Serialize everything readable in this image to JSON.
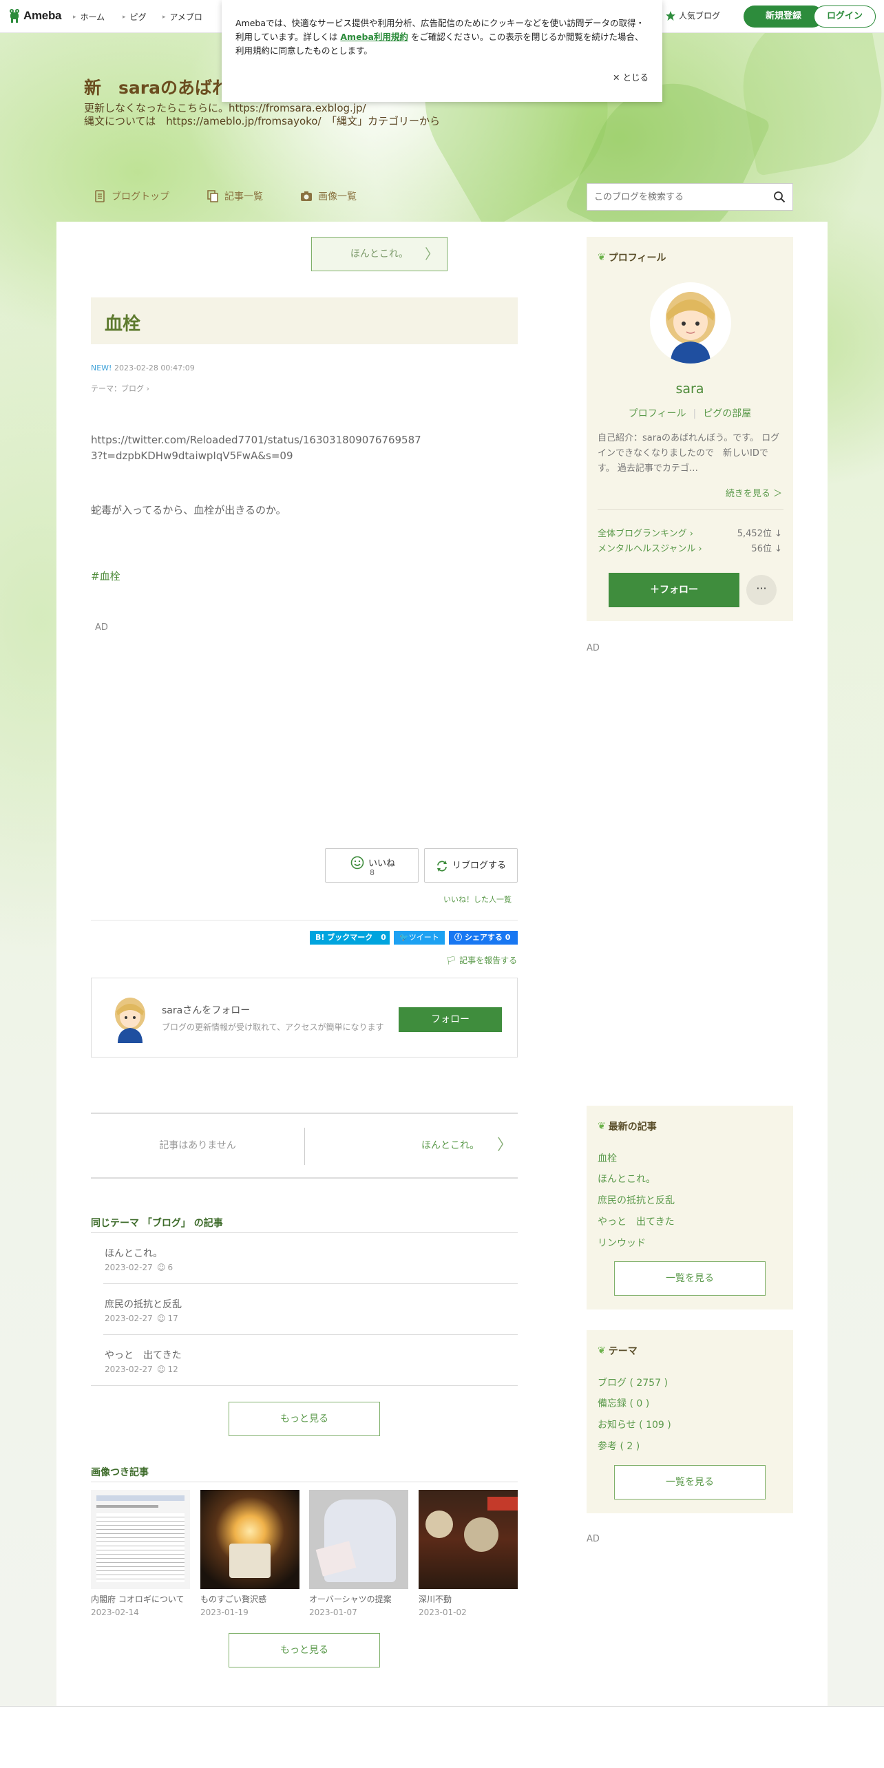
{
  "header": {
    "logo": "Ameba",
    "nav": [
      "ホーム",
      "ピグ",
      "アメブロ"
    ],
    "popular_blogs": "人気ブログ",
    "signup": "新規登録",
    "login": "ログイン"
  },
  "cookie": {
    "text_before": "Amebaでは、快適なサービス提供や利用分析、広告配信のためにクッキーなどを使い訪問データの取得・利用しています。詳しくは",
    "link": "Ameba利用規約",
    "text_after": "をご確認ください。この表示を閉じるか閲覧を続けた場合、利用規約に同意したものとします。",
    "close": "とじる"
  },
  "blog": {
    "title": "新　saraのあばれ",
    "description_line1": "更新しなくなったらこちらに。https://fromsara.exblog.jp/",
    "description_line2": "縄文については　https://ameblo.jp/fromsayoko/　「縄文」カテゴリーから",
    "nav": {
      "top": "ブログトップ",
      "articles": "記事一覧",
      "images": "画像一覧"
    },
    "search_placeholder": "このブログを検索する"
  },
  "article": {
    "prev_top": "ほんとこれ。",
    "title": "血栓",
    "new_badge": "NEW!",
    "datetime": "2023-02-28 00:47:09",
    "theme_label": "テーマ：",
    "theme": "ブログ",
    "body_url": "https://twitter.com/Reloaded7701/status/1630318090767695873?t=dzpbKDHw9dtaiwpIqV5FwA&s=09",
    "body_text": "蛇毒が入ってるから、血栓が出きるのか。",
    "hashtag": "#血栓",
    "ad": "AD",
    "like_label": "いいね",
    "like_count": "8",
    "reblog": "リブログする",
    "like_list": "いいね！した人一覧",
    "hatena": "ブックマーク",
    "hatena_count": "0",
    "tweet": "ツイート",
    "fb_share": "シェアする",
    "fb_count": "0",
    "report": "記事を報告する"
  },
  "follow_box": {
    "name": "saraさんをフォロー",
    "sub": "ブログの更新情報が受け取れて、アクセスが簡単になります",
    "button": "フォロー"
  },
  "pager": {
    "prev": "記事はありません",
    "next": "ほんとこれ。"
  },
  "same_theme": {
    "heading": "同じテーマ 「ブログ」 の記事",
    "items": [
      {
        "title": "ほんとこれ。",
        "date": "2023-02-27",
        "likes": "6"
      },
      {
        "title": "庶民の抵抗と反乱",
        "date": "2023-02-27",
        "likes": "17"
      },
      {
        "title": "やっと　出てきた",
        "date": "2023-02-27",
        "likes": "12"
      }
    ],
    "more": "もっと見る"
  },
  "image_articles": {
    "heading": "画像つき記事",
    "items": [
      {
        "title": "内閣府 コオロギについて",
        "date": "2023-02-14"
      },
      {
        "title": "ものすごい贅沢感",
        "date": "2023-01-19"
      },
      {
        "title": "オーバーシャツの提案",
        "date": "2023-01-07"
      },
      {
        "title": "深川不動",
        "date": "2023-01-02"
      }
    ],
    "more": "もっと見る"
  },
  "sidebar": {
    "profile": {
      "heading": "プロフィール",
      "name": "sara",
      "link1": "プロフィール",
      "link2": "ピグの部屋",
      "intro": "自己紹介：saraのあばれんぼう。です。 ログインできなくなりましたので　新しいIDです。 過去記事でカテゴ…",
      "more": "続きを見る ＞",
      "rank1_label": "全体ブログランキング",
      "rank1_value": "5,452位 ↓",
      "rank2_label": "メンタルヘルスジャンル",
      "rank2_value": "56位 ↓",
      "follow": "フォロー",
      "more_menu": "···"
    },
    "ad": "AD",
    "latest": {
      "heading": "最新の記事",
      "items": [
        "血栓",
        "ほんとこれ。",
        "庶民の抵抗と反乱",
        "やっと　出てきた",
        "リンウッド"
      ],
      "more": "一覧を見る"
    },
    "themes": {
      "heading": "テーマ",
      "items": [
        "ブログ ( 2757 )",
        "備忘録 ( 0 )",
        "お知らせ ( 109 )",
        "参考 ( 2 )"
      ],
      "more": "一覧を見る"
    },
    "ad2": "AD"
  }
}
